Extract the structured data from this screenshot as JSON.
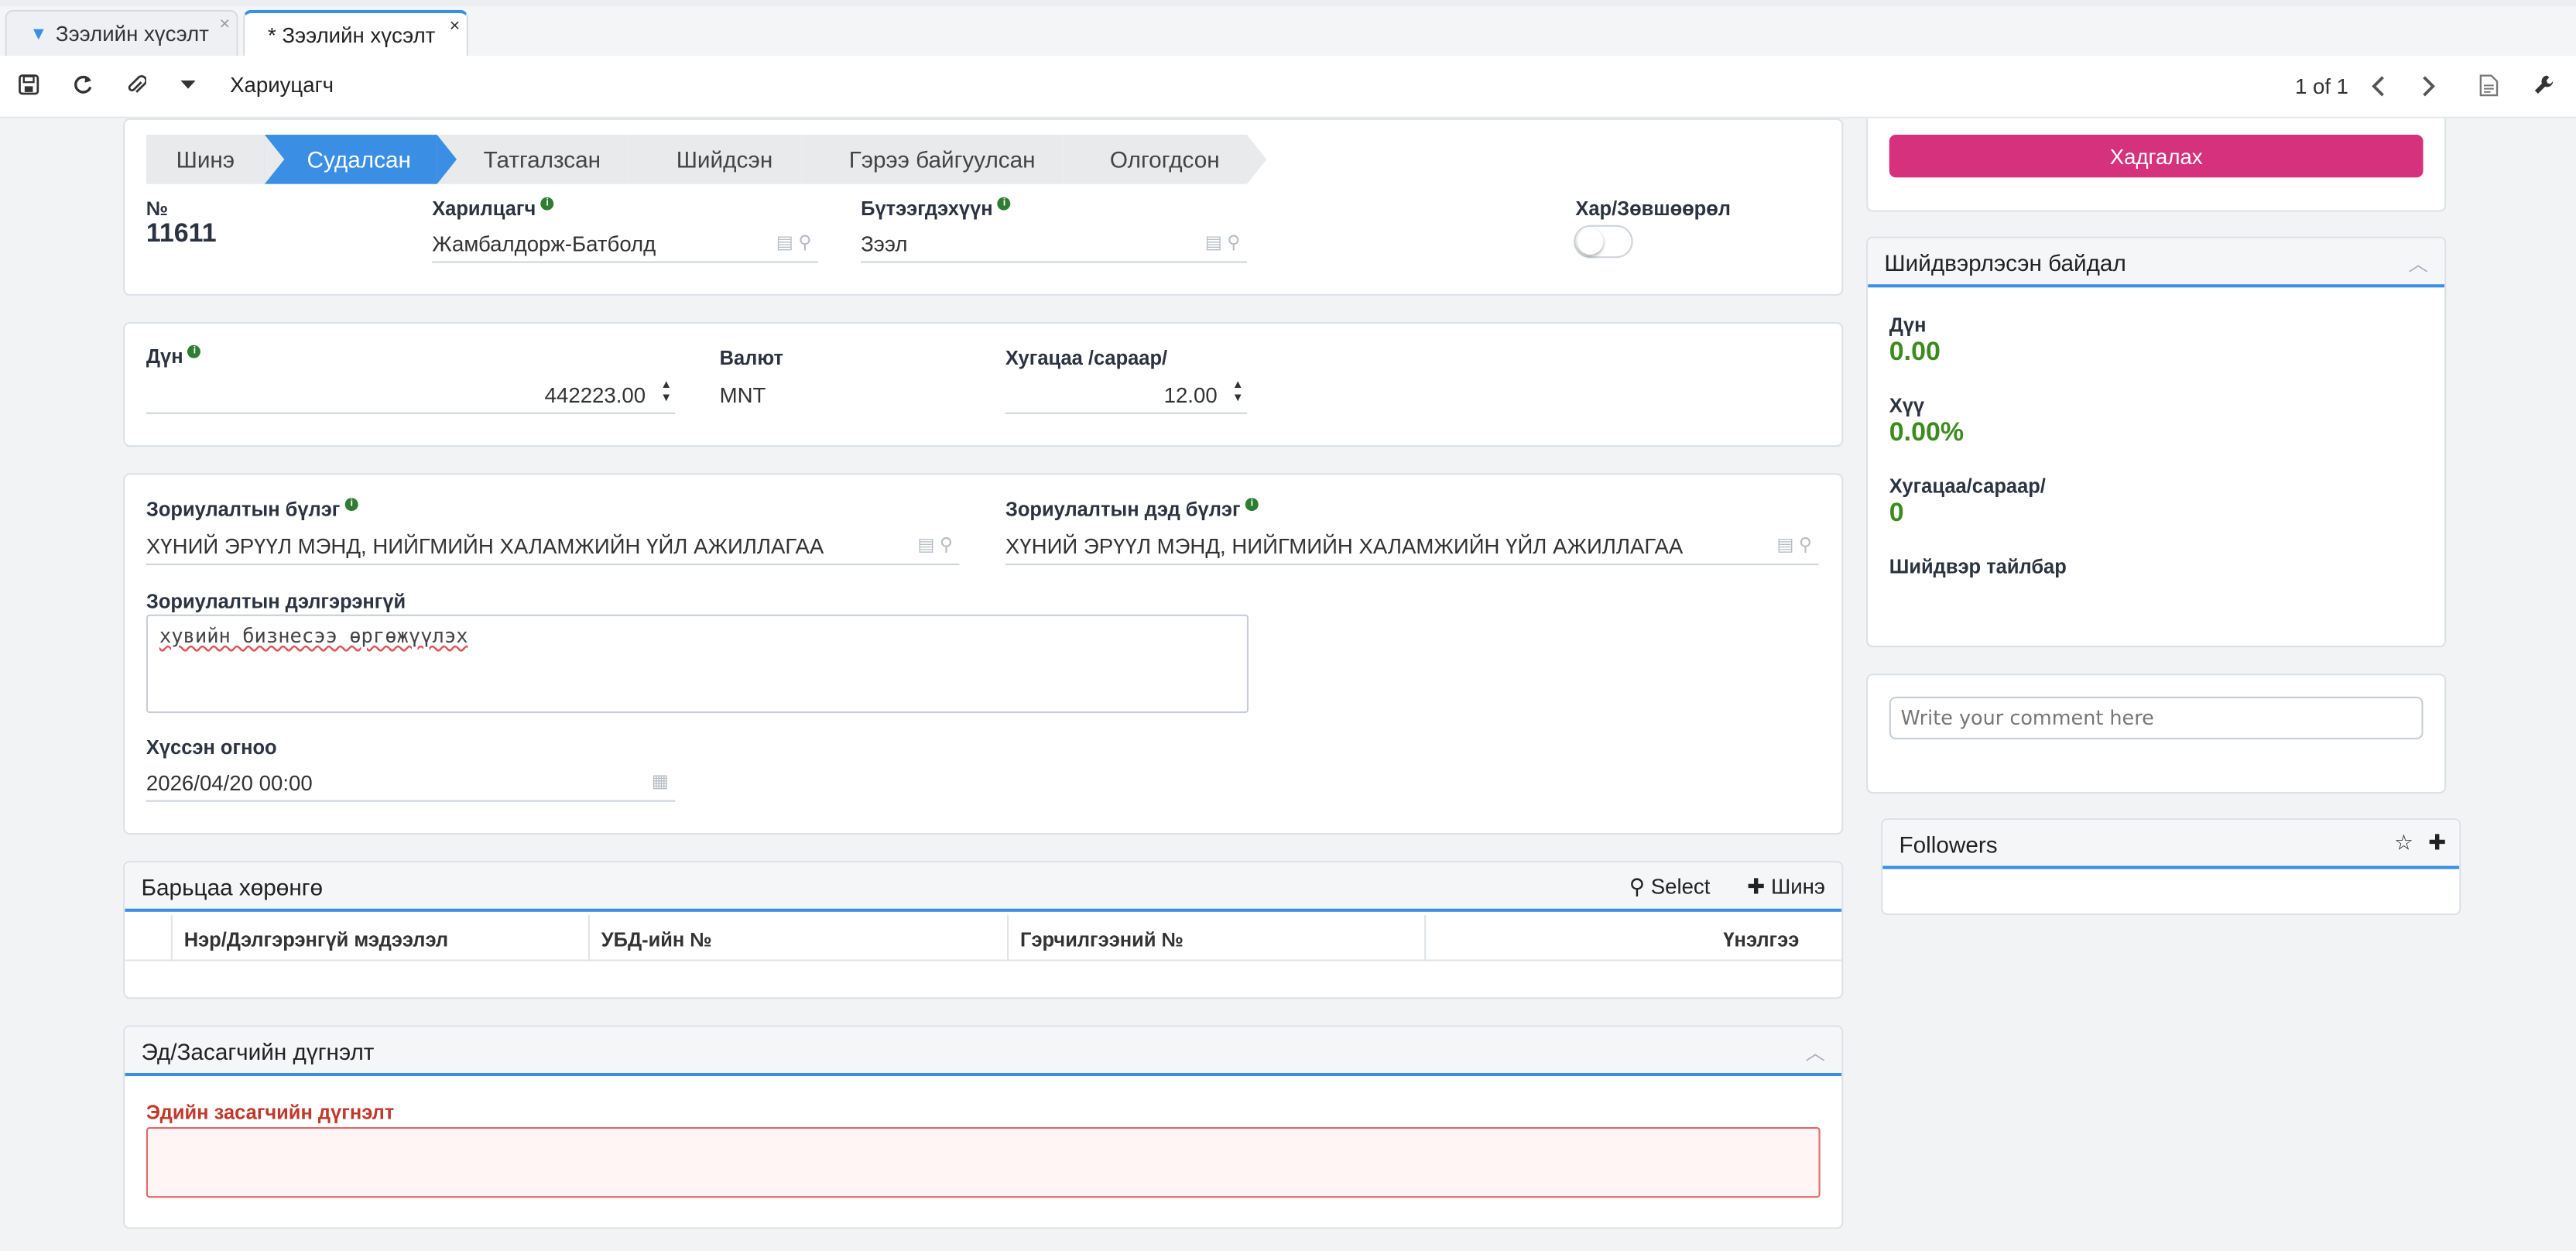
{
  "tabs": [
    {
      "label": "Зээлийн хүсэлт",
      "close": "×"
    },
    {
      "label": "* Зээлийн хүсэлт",
      "close": "×"
    }
  ],
  "toolbar": {
    "title": "Хариуцагч",
    "pager": "1 of 1"
  },
  "pipeline": [
    "Шинэ",
    "Судалсан",
    "Татгалзсан",
    "Шийдсэн",
    "Гэрээ байгуулсан",
    "Олгогдсон"
  ],
  "header_card": {
    "no_label": "№",
    "no_value": "11611",
    "customer_label": "Харилцагч",
    "customer_value": "Жамбалдорж-Батболд",
    "product_label": "Бүтээгдэхүүн",
    "product_value": "Зээл",
    "approval_label": "Хар/Зөвшөөрөл"
  },
  "amount_card": {
    "amount_label": "Дүн",
    "amount_value": "442223.00",
    "currency_label": "Валют",
    "currency_value": "MNT",
    "term_label": "Хугацаа /сараар/",
    "term_value": "12.00"
  },
  "purpose_card": {
    "group_label": "Зориулалтын бүлэг",
    "group_value": "ХҮНИЙ ЭРҮҮЛ МЭНД, НИЙГМИЙН ХАЛАМЖИЙН ҮЙЛ АЖИЛЛАГАА",
    "subgroup_label": "Зориулалтын дэд бүлэг",
    "subgroup_value": "ХҮНИЙ ЭРҮҮЛ МЭНД, НИЙГМИЙН ХАЛАМЖИЙН ҮЙЛ АЖИЛЛАГАА",
    "detail_label": "Зориулалтын дэлгэрэнгүй",
    "detail_value": "хувийн бизнесээ өргөжүүлэх",
    "date_label": "Хүссэн огноо",
    "date_value": "2026/04/20 00:00"
  },
  "collateral": {
    "title": "Барьцаа хөрөнгө",
    "select_label": "Select",
    "new_label": "Шинэ",
    "columns": [
      "Нэр/Дэлгэрэнгүй мэдээлэл",
      "УБД-ийн №",
      "Гэрчилгээний №",
      "Үнэлгээ"
    ]
  },
  "economist": {
    "title": "Эд/Засагчийн дүгнэлт",
    "field_label": "Эдийн засагчийн дүгнэлт"
  },
  "side": {
    "save_label": "Хадгалах",
    "decision_title": "Шийдвэрлэсэн байдал",
    "amount_label": "Дүн",
    "amount_value": "0.00",
    "rate_label": "Хүү",
    "rate_value": "0.00%",
    "term_label": "Хугацаа/сараар/",
    "term_value": "0",
    "note_label": "Шийдвэр тайлбар",
    "comment_placeholder": "Write your comment here",
    "followers_title": "Followers"
  },
  "colors": {
    "accent": "#3a8fe4",
    "save": "#d6317c",
    "value_green": "#3d8b1e",
    "error": "#c0392b"
  }
}
